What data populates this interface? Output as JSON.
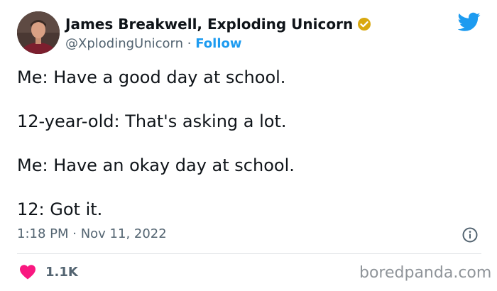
{
  "tweet": {
    "author": {
      "display_name": "James Breakwell, Exploding Unicorn",
      "handle": "@XplodingUnicorn",
      "separator": "·",
      "follow_label": "Follow",
      "verified_color": "#d9a80f"
    },
    "brand_icon": "twitter-bird-icon",
    "brand_color": "#1d9bf0",
    "text_lines": [
      "Me: Have a good day at school.",
      "12-year-old: That's asking a lot.",
      "Me: Have an okay day at school.",
      "12: Got it."
    ],
    "timestamp": "1:18 PM · Nov 11, 2022",
    "likes": "1.1K",
    "like_color": "#f91880"
  },
  "watermark": "boredpanda.com"
}
